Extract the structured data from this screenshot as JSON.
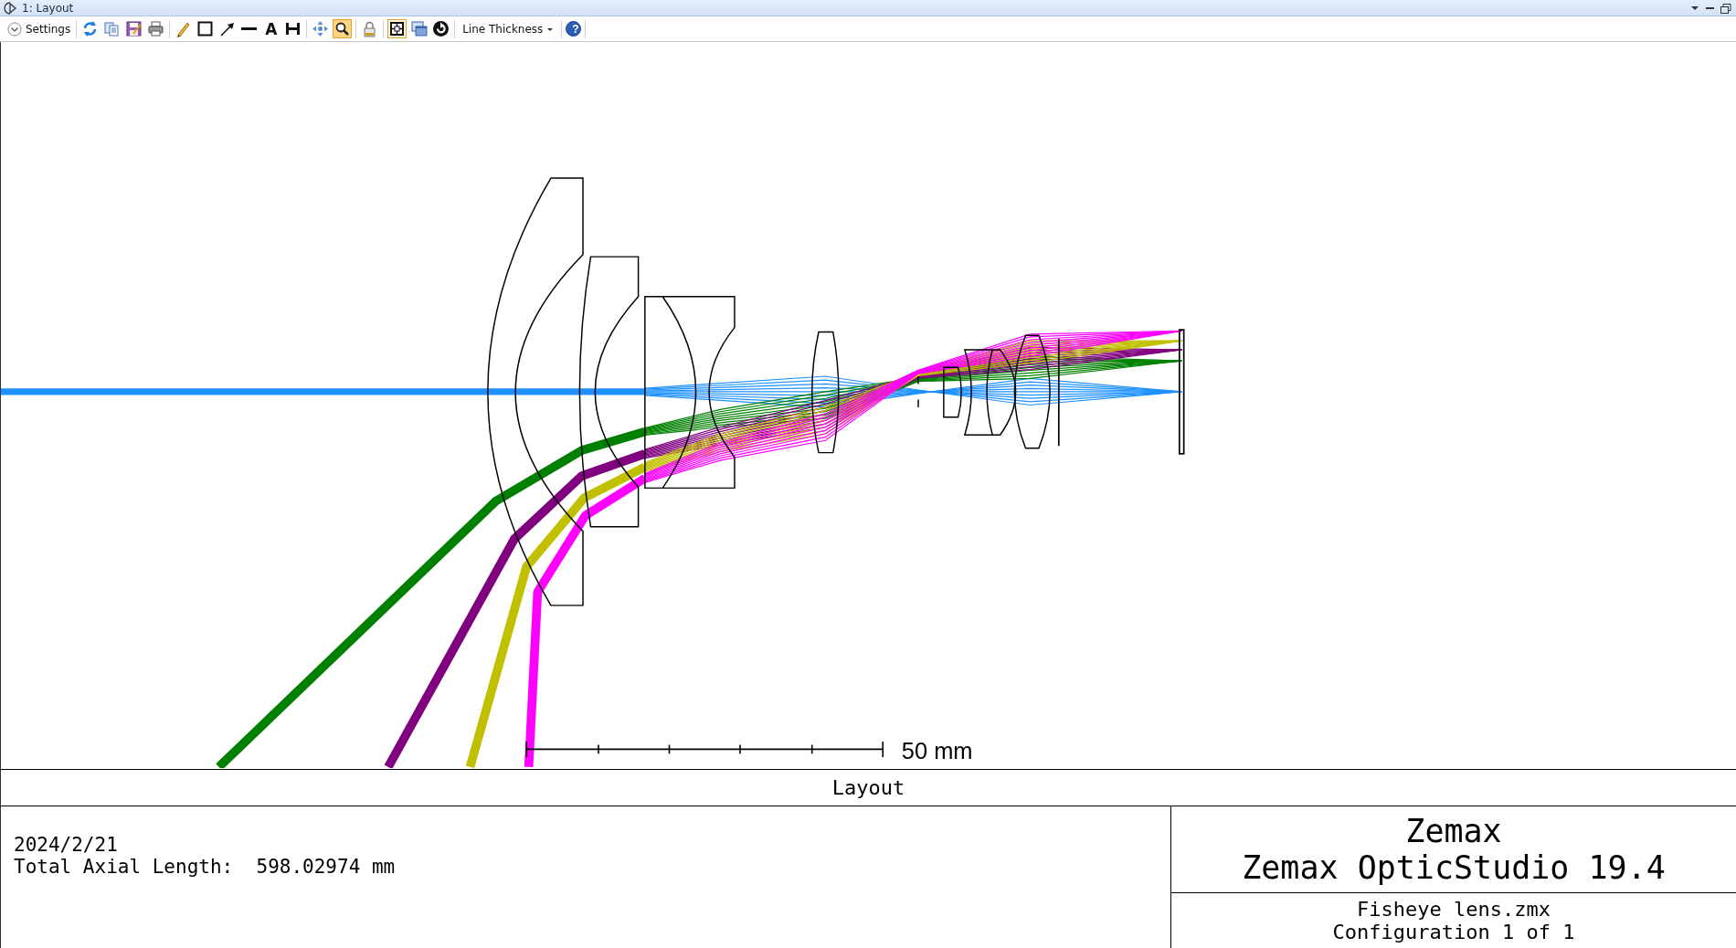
{
  "window": {
    "title": "1: Layout"
  },
  "toolbar": [
    {
      "items": [
        {
          "kind": "settings",
          "label": "Settings"
        }
      ]
    },
    {
      "items": [
        {
          "kind": "refresh",
          "selected": false
        },
        {
          "kind": "copy",
          "selected": false
        },
        {
          "kind": "save",
          "selected": false
        },
        {
          "kind": "print",
          "selected": false
        }
      ]
    },
    {
      "items": [
        {
          "kind": "pencil",
          "selected": false
        },
        {
          "kind": "rectangle",
          "selected": false
        },
        {
          "kind": "arrow",
          "selected": false
        },
        {
          "kind": "line",
          "selected": false
        },
        {
          "kind": "text",
          "label": "A",
          "selected": false
        },
        {
          "kind": "dimension",
          "selected": false
        }
      ]
    },
    {
      "items": [
        {
          "kind": "pan",
          "selected": false
        },
        {
          "kind": "zoom",
          "selected": true
        }
      ]
    },
    {
      "items": [
        {
          "kind": "lock",
          "selected": false
        }
      ]
    },
    {
      "items": [
        {
          "kind": "fit",
          "selected": true
        },
        {
          "kind": "windows",
          "selected": false
        },
        {
          "kind": "reset",
          "selected": false
        }
      ]
    },
    {
      "items": [
        {
          "kind": "dropdown",
          "label": "Line Thickness"
        }
      ]
    },
    {
      "items": [
        {
          "kind": "help",
          "label": "?"
        }
      ]
    }
  ],
  "fields": [
    {
      "color": "#1e90ff"
    },
    {
      "color": "#008000"
    },
    {
      "color": "#800080"
    },
    {
      "color": "#c0c000"
    },
    {
      "color": "#ff00ff"
    }
  ],
  "scale_bar": {
    "label": "50 mm"
  },
  "plot_title": "Layout",
  "info": {
    "date": "2024/2/21",
    "axial_length": "Total Axial Length:  598.02974 mm"
  },
  "credits": {
    "company": "Zemax",
    "product": "Zemax OpticStudio 19.4",
    "file": "Fisheye lens.zmx",
    "configuration": "Configuration 1 of 1"
  }
}
